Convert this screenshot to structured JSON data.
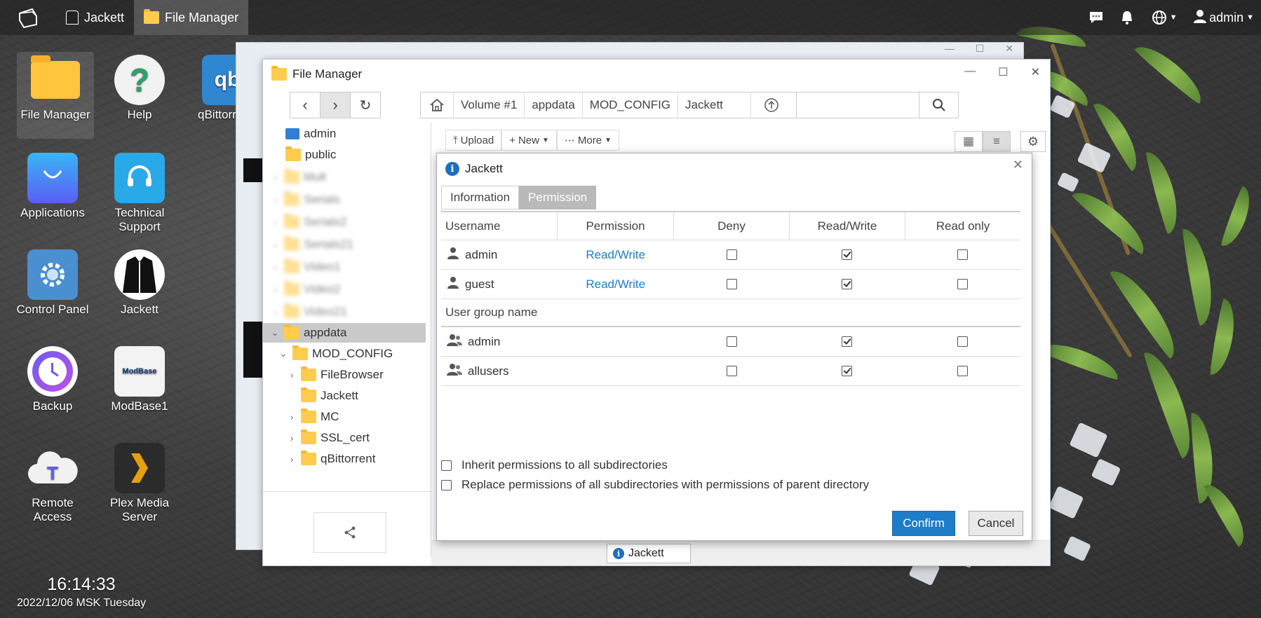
{
  "taskbar": {
    "items": [
      {
        "label": "Jackett",
        "active": false
      },
      {
        "label": "File Manager",
        "active": true
      }
    ],
    "user": "admin"
  },
  "desktop": {
    "icons": [
      {
        "label": "File Manager"
      },
      {
        "label": "Help"
      },
      {
        "label": "qBittorr"
      },
      {
        "label": "Applications"
      },
      {
        "label": "Technical Support"
      },
      {
        "label": "Control Panel"
      },
      {
        "label": "Jackett"
      },
      {
        "label": "Backup"
      },
      {
        "label": "ModBase1"
      },
      {
        "label": "Remote Access"
      },
      {
        "label": "Plex Media Server"
      }
    ],
    "modbase_logo_text": "ModBase",
    "clock": {
      "time": "16:14:33",
      "date": "2022/12/06 MSK Tuesday"
    }
  },
  "file_manager": {
    "title": "File Manager",
    "breadcrumb": [
      "Volume #1",
      "appdata",
      "MOD_CONFIG",
      "Jackett"
    ],
    "search": {
      "placeholder": ""
    },
    "actions": {
      "upload": "Upload",
      "new": "New",
      "more": "More"
    },
    "tree": [
      {
        "label": "admin",
        "depth": 0
      },
      {
        "label": "public",
        "depth": 0
      },
      {
        "label": "Mult",
        "depth": 0
      },
      {
        "label": "Serials",
        "depth": 0
      },
      {
        "label": "Serials2",
        "depth": 0
      },
      {
        "label": "Serials21",
        "depth": 0
      },
      {
        "label": "Video1",
        "depth": 0
      },
      {
        "label": "Video2",
        "depth": 0
      },
      {
        "label": "Video21",
        "depth": 0
      },
      {
        "label": "appdata",
        "depth": 0
      },
      {
        "label": "MOD_CONFIG",
        "depth": 1
      },
      {
        "label": "FileBrowser",
        "depth": 2
      },
      {
        "label": "Jackett",
        "depth": 2
      },
      {
        "label": "MC",
        "depth": 2
      },
      {
        "label": "SSL_cert",
        "depth": 2
      },
      {
        "label": "qBittorrent",
        "depth": 2
      }
    ],
    "minimized_dialog": "Jackett"
  },
  "dialog": {
    "title": "Jackett",
    "tabs": [
      "Information",
      "Permission"
    ],
    "columns": [
      "Username",
      "Permission",
      "Deny",
      "Read/Write",
      "Read only"
    ],
    "users": [
      {
        "name": "admin",
        "permission": "Read/Write",
        "deny": false,
        "rw": true,
        "ro": false
      },
      {
        "name": "guest",
        "permission": "Read/Write",
        "deny": false,
        "rw": true,
        "ro": false
      }
    ],
    "group_header": "User group name",
    "groups": [
      {
        "name": "admin",
        "deny": false,
        "rw": true,
        "ro": false
      },
      {
        "name": "allusers",
        "deny": false,
        "rw": true,
        "ro": false
      }
    ],
    "inherit_label": "Inherit permissions to all subdirectories",
    "replace_label": "Replace permissions of all subdirectories with permissions of parent directory",
    "confirm": "Confirm",
    "cancel": "Cancel"
  },
  "colors": {
    "accent": "#1e7dc8",
    "folder": "#ffcc4d",
    "active_tab": "#b9b9b9"
  }
}
